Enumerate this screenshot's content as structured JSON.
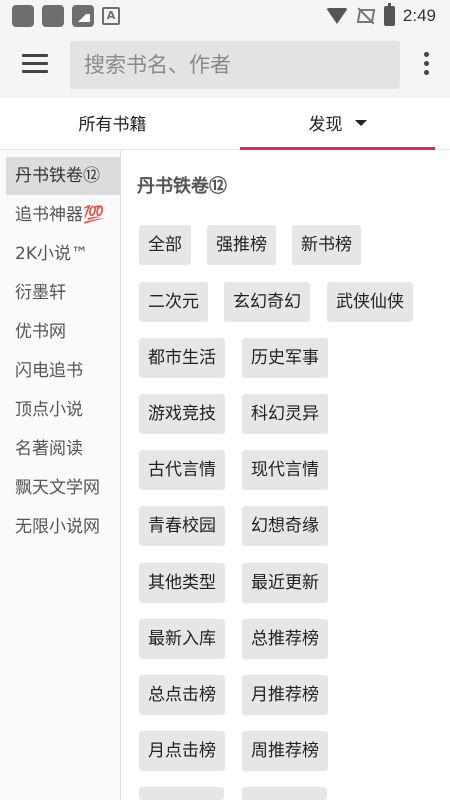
{
  "status_bar": {
    "time": "2:49",
    "battery_icon": "battery-charging-icon",
    "left_icons": [
      "app-icon",
      "app-icon",
      "image-icon",
      "a-icon"
    ]
  },
  "app_bar": {
    "search_placeholder": "搜索书名、作者"
  },
  "tabs": [
    {
      "label": "所有书籍",
      "selected": false
    },
    {
      "label": "发现",
      "selected": true
    }
  ],
  "colors": {
    "accent": "#e0245e",
    "chip_bg": "#e6e6e6",
    "sidebar_selected": "#dcdcdc"
  },
  "sidebar": {
    "selected_index": 0,
    "items": [
      "丹书铁卷⑫",
      "追书神器💯",
      "2K小说™",
      "衍墨轩",
      "优书网",
      "闪电追书",
      "顶点小说",
      "名著阅读",
      "飘天文学网",
      "无限小说网"
    ]
  },
  "main": {
    "title": "丹书铁卷⑫",
    "rows": [
      [
        "全部",
        "强推榜",
        "新书榜"
      ],
      [
        "二次元",
        "玄幻奇幻",
        "武侠仙侠"
      ],
      [
        "都市生活",
        "历史军事"
      ],
      [
        "游戏竞技",
        "科幻灵异"
      ],
      [
        "古代言情",
        "现代言情"
      ],
      [
        "青春校园",
        "幻想奇缘"
      ],
      [
        "其他类型",
        "最近更新"
      ],
      [
        "最新入库",
        "总推荐榜"
      ],
      [
        "总点击榜",
        "月推荐榜"
      ],
      [
        "月点击榜",
        "周推荐榜"
      ]
    ]
  }
}
